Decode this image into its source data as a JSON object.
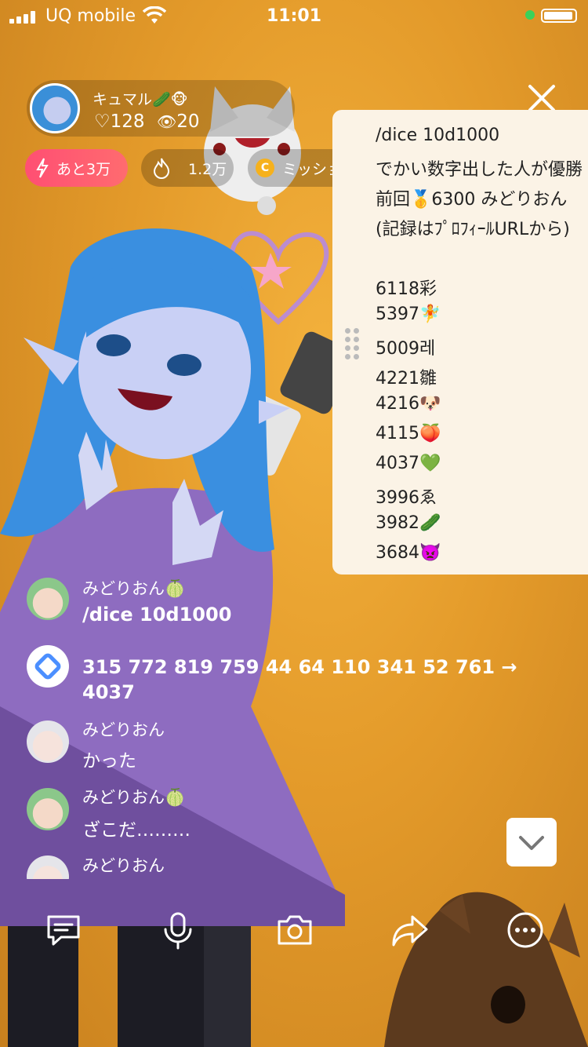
{
  "status_bar": {
    "carrier": "UQ mobile",
    "time": "11:01"
  },
  "host": {
    "name": "キュマル🥒🐵",
    "likes": "♡128",
    "viewers": "20"
  },
  "badges": {
    "remaining": "あと3万",
    "points": "1.2万",
    "mission": "ミッション"
  },
  "panel": {
    "lines": [
      "/dice 10d1000",
      "でかい数字出した人が優勝",
      "前回🥇6300 みどりおん",
      "(記録はﾌﾟﾛﾌｨｰﾙURLから)",
      "",
      "6118彩",
      "5397🧚",
      "5009레",
      "4221雛",
      "4216🐶",
      "4115🍑",
      "4037💚",
      "3996ゑ",
      "3982🥒",
      "3684👿"
    ]
  },
  "chat": [
    {
      "name": "みどりおん🍈",
      "message": "/dice 10d1000"
    },
    {
      "name": "",
      "message": "315 772 819 759 44 64 110 341 52 761 → 4037"
    },
    {
      "name": "みどりおん",
      "message": "かった"
    },
    {
      "name": "みどりおん🍈",
      "message": "ざこだ………"
    },
    {
      "name": "みどりおん",
      "message": ""
    }
  ],
  "icons": [
    "comment-icon",
    "mic-icon",
    "camera-icon",
    "share-icon",
    "more-icon",
    "chevron-down-icon",
    "close-icon",
    "heart-icon",
    "eye-icon",
    "fire-icon",
    "lightning-icon"
  ],
  "colors": {
    "background": "#e39a2a",
    "panel": "#fbf3e6",
    "badge_red": "#ff5570"
  }
}
